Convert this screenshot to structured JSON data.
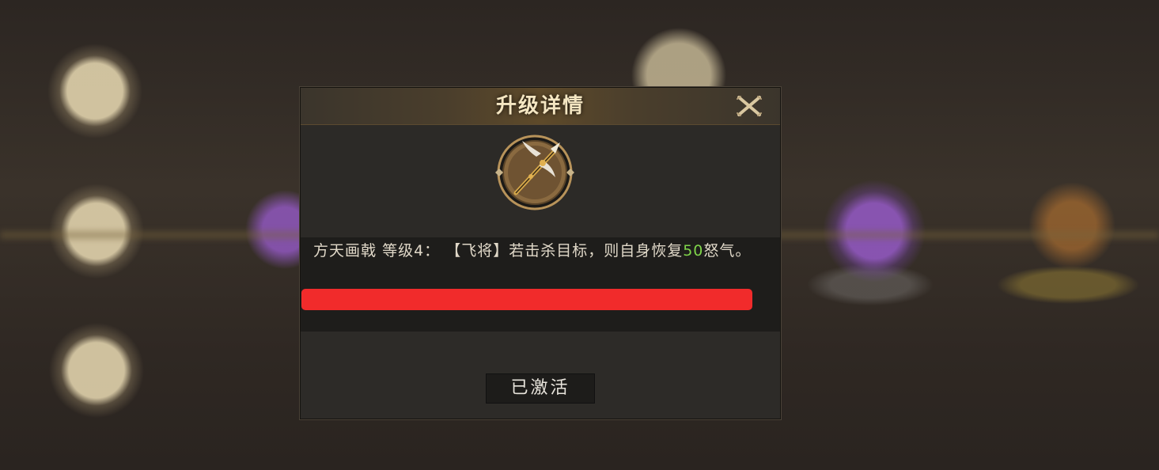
{
  "dialog": {
    "title": "升级详情",
    "close_icon": "close-x-icon",
    "item_icon": "halberd-weapon-icon",
    "description": {
      "weapon_name": "方天画戟",
      "level_label": "等级4：",
      "effect_part1": "【飞将】若击杀目标，则自身恢复",
      "effect_value": "50",
      "effect_part2": "怒气。"
    },
    "status_button": "已激活"
  },
  "colors": {
    "title_text": "#f4e6c2",
    "highlight_value": "#7fd44a",
    "redaction_bar": "#f12b2b"
  }
}
